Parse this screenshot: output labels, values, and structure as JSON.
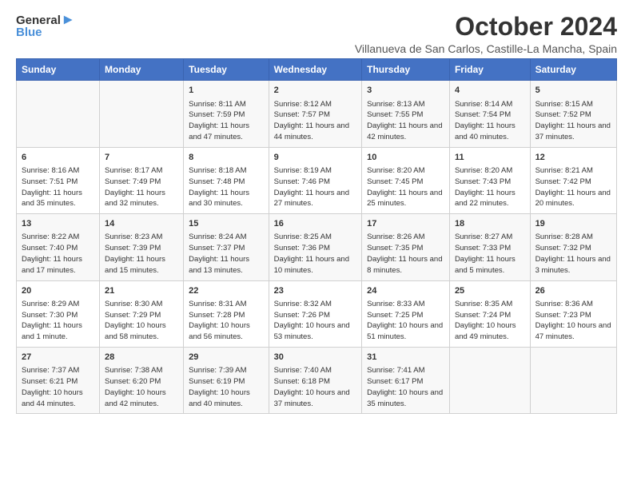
{
  "header": {
    "logo_line1": "General",
    "logo_line2": "Blue",
    "month": "October 2024",
    "location": "Villanueva de San Carlos, Castille-La Mancha, Spain"
  },
  "days_of_week": [
    "Sunday",
    "Monday",
    "Tuesday",
    "Wednesday",
    "Thursday",
    "Friday",
    "Saturday"
  ],
  "weeks": [
    [
      {
        "day": "",
        "info": ""
      },
      {
        "day": "",
        "info": ""
      },
      {
        "day": "1",
        "info": "Sunrise: 8:11 AM\nSunset: 7:59 PM\nDaylight: 11 hours and 47 minutes."
      },
      {
        "day": "2",
        "info": "Sunrise: 8:12 AM\nSunset: 7:57 PM\nDaylight: 11 hours and 44 minutes."
      },
      {
        "day": "3",
        "info": "Sunrise: 8:13 AM\nSunset: 7:55 PM\nDaylight: 11 hours and 42 minutes."
      },
      {
        "day": "4",
        "info": "Sunrise: 8:14 AM\nSunset: 7:54 PM\nDaylight: 11 hours and 40 minutes."
      },
      {
        "day": "5",
        "info": "Sunrise: 8:15 AM\nSunset: 7:52 PM\nDaylight: 11 hours and 37 minutes."
      }
    ],
    [
      {
        "day": "6",
        "info": "Sunrise: 8:16 AM\nSunset: 7:51 PM\nDaylight: 11 hours and 35 minutes."
      },
      {
        "day": "7",
        "info": "Sunrise: 8:17 AM\nSunset: 7:49 PM\nDaylight: 11 hours and 32 minutes."
      },
      {
        "day": "8",
        "info": "Sunrise: 8:18 AM\nSunset: 7:48 PM\nDaylight: 11 hours and 30 minutes."
      },
      {
        "day": "9",
        "info": "Sunrise: 8:19 AM\nSunset: 7:46 PM\nDaylight: 11 hours and 27 minutes."
      },
      {
        "day": "10",
        "info": "Sunrise: 8:20 AM\nSunset: 7:45 PM\nDaylight: 11 hours and 25 minutes."
      },
      {
        "day": "11",
        "info": "Sunrise: 8:20 AM\nSunset: 7:43 PM\nDaylight: 11 hours and 22 minutes."
      },
      {
        "day": "12",
        "info": "Sunrise: 8:21 AM\nSunset: 7:42 PM\nDaylight: 11 hours and 20 minutes."
      }
    ],
    [
      {
        "day": "13",
        "info": "Sunrise: 8:22 AM\nSunset: 7:40 PM\nDaylight: 11 hours and 17 minutes."
      },
      {
        "day": "14",
        "info": "Sunrise: 8:23 AM\nSunset: 7:39 PM\nDaylight: 11 hours and 15 minutes."
      },
      {
        "day": "15",
        "info": "Sunrise: 8:24 AM\nSunset: 7:37 PM\nDaylight: 11 hours and 13 minutes."
      },
      {
        "day": "16",
        "info": "Sunrise: 8:25 AM\nSunset: 7:36 PM\nDaylight: 11 hours and 10 minutes."
      },
      {
        "day": "17",
        "info": "Sunrise: 8:26 AM\nSunset: 7:35 PM\nDaylight: 11 hours and 8 minutes."
      },
      {
        "day": "18",
        "info": "Sunrise: 8:27 AM\nSunset: 7:33 PM\nDaylight: 11 hours and 5 minutes."
      },
      {
        "day": "19",
        "info": "Sunrise: 8:28 AM\nSunset: 7:32 PM\nDaylight: 11 hours and 3 minutes."
      }
    ],
    [
      {
        "day": "20",
        "info": "Sunrise: 8:29 AM\nSunset: 7:30 PM\nDaylight: 11 hours and 1 minute."
      },
      {
        "day": "21",
        "info": "Sunrise: 8:30 AM\nSunset: 7:29 PM\nDaylight: 10 hours and 58 minutes."
      },
      {
        "day": "22",
        "info": "Sunrise: 8:31 AM\nSunset: 7:28 PM\nDaylight: 10 hours and 56 minutes."
      },
      {
        "day": "23",
        "info": "Sunrise: 8:32 AM\nSunset: 7:26 PM\nDaylight: 10 hours and 53 minutes."
      },
      {
        "day": "24",
        "info": "Sunrise: 8:33 AM\nSunset: 7:25 PM\nDaylight: 10 hours and 51 minutes."
      },
      {
        "day": "25",
        "info": "Sunrise: 8:35 AM\nSunset: 7:24 PM\nDaylight: 10 hours and 49 minutes."
      },
      {
        "day": "26",
        "info": "Sunrise: 8:36 AM\nSunset: 7:23 PM\nDaylight: 10 hours and 47 minutes."
      }
    ],
    [
      {
        "day": "27",
        "info": "Sunrise: 7:37 AM\nSunset: 6:21 PM\nDaylight: 10 hours and 44 minutes."
      },
      {
        "day": "28",
        "info": "Sunrise: 7:38 AM\nSunset: 6:20 PM\nDaylight: 10 hours and 42 minutes."
      },
      {
        "day": "29",
        "info": "Sunrise: 7:39 AM\nSunset: 6:19 PM\nDaylight: 10 hours and 40 minutes."
      },
      {
        "day": "30",
        "info": "Sunrise: 7:40 AM\nSunset: 6:18 PM\nDaylight: 10 hours and 37 minutes."
      },
      {
        "day": "31",
        "info": "Sunrise: 7:41 AM\nSunset: 6:17 PM\nDaylight: 10 hours and 35 minutes."
      },
      {
        "day": "",
        "info": ""
      },
      {
        "day": "",
        "info": ""
      }
    ]
  ]
}
